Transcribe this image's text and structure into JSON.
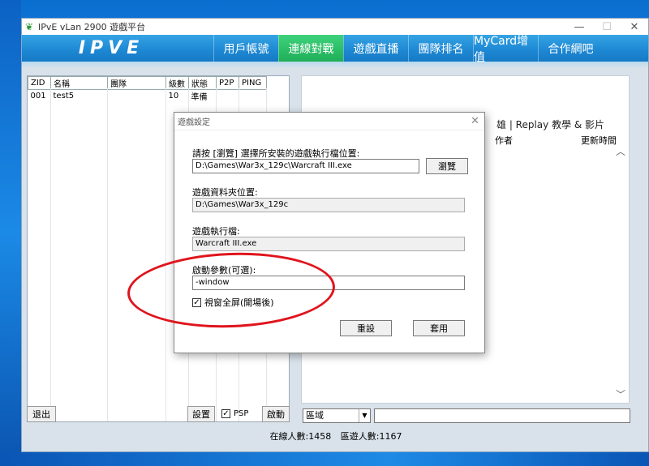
{
  "window": {
    "title": "IPvE vLan 2900 遊戲平台",
    "logo": "IPVE"
  },
  "nav": {
    "tabs": [
      {
        "label": "用戶帳號"
      },
      {
        "label": "連線對戰"
      },
      {
        "label": "遊戲直播"
      },
      {
        "label": "團隊排名"
      },
      {
        "label": "MyCard增值"
      },
      {
        "label": "合作網吧"
      }
    ],
    "active_tab": "連線對戰"
  },
  "room_table": {
    "columns": [
      "ZID",
      "名稱",
      "團隊",
      "級數",
      "狀態",
      "P2P",
      "PING"
    ],
    "rows": [
      {
        "zid": "001",
        "name": "test5",
        "team": "",
        "level": "10",
        "status": "準備",
        "p2p": "",
        "ping": ""
      }
    ]
  },
  "right_panel": {
    "tabs_text": "雄 | Replay 教學 & 影片",
    "col_author": "作者",
    "col_updated": "更新時間"
  },
  "bottom_left": {
    "exit_label": "退出",
    "settings_label": "設置",
    "psp_label": "PSP",
    "psp_checked": true,
    "start_label": "啟動"
  },
  "bottom_right": {
    "region_value": "區域",
    "search_value": ""
  },
  "status_bar": {
    "online": "在線人數:1458",
    "region_online": "區遊人數:1167"
  },
  "dialog": {
    "title": "遊戲設定",
    "exe_prompt": "請按 [瀏覽] 選擇所安裝的遊戲執行檔位置:",
    "exe_path": "D:\\Games\\War3x_129c\\Warcraft III.exe",
    "browse_label": "瀏覽",
    "data_folder_label": "遊戲資料夾位置:",
    "data_folder_value": "D:\\Games\\War3x_129c",
    "exe_label": "遊戲執行檔:",
    "exe_value": "Warcraft III.exe",
    "params_label": "啟動參數(可選):",
    "params_value": "-window",
    "fullscreen_label": "視窗全屏(開場後)",
    "fullscreen_checked": true,
    "reset_label": "重設",
    "apply_label": "套用"
  },
  "colors": {
    "nav_blue": "#1d87d3",
    "active_tab_green": "#1eae57",
    "annotation_red": "#e0141c"
  }
}
